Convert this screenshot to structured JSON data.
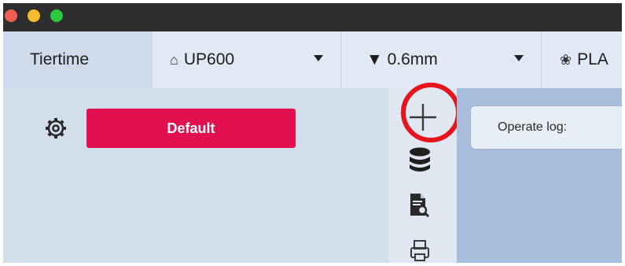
{
  "tabs": {
    "brand": "Tiertime",
    "printer": {
      "icon": "printer-outline-icon",
      "label": "UP600",
      "icon_glyph": "⌂"
    },
    "nozzle": {
      "icon": "triangle-down-icon",
      "label": "▼ 0.6mm"
    },
    "material": {
      "icon": "flower-icon",
      "label": "PLA",
      "icon_glyph": "❀"
    }
  },
  "left_panel": {
    "settings_icon": "gear-icon",
    "profile_button_label": "Default",
    "profile_button_color": "#e2104f"
  },
  "toolbar": {
    "add_icon": "plus-icon",
    "database_icon": "database-icon",
    "document_icon": "document-search-icon",
    "printer_icon": "printer-icon",
    "highlight_color": "#e8141c"
  },
  "right_panel": {
    "log_label": "Operate log:"
  }
}
